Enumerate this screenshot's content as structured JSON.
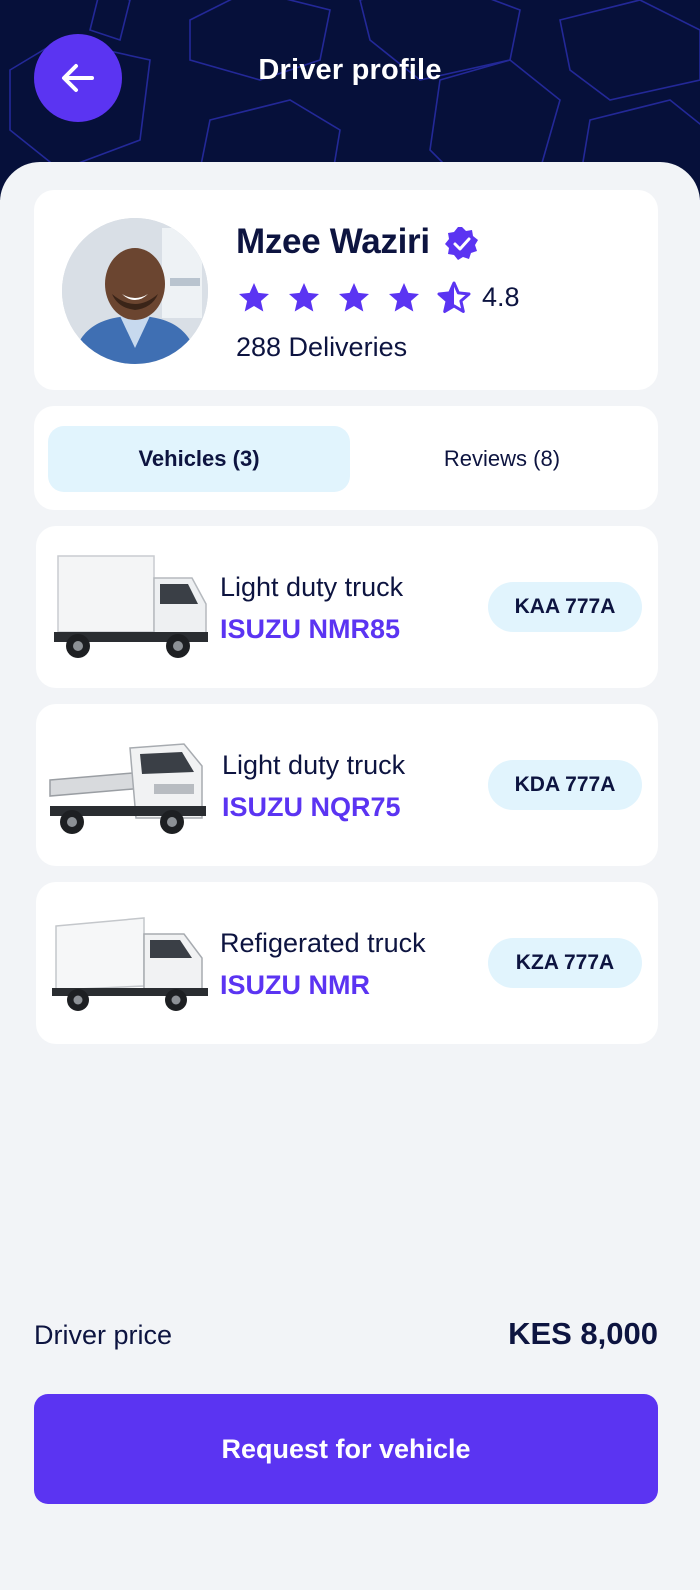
{
  "header": {
    "title": "Driver profile",
    "back_icon": "arrow-left-icon"
  },
  "driver": {
    "name": "Mzee Waziri",
    "verified_icon": "verified-badge-icon",
    "rating": "4.8",
    "rating_value": 4.5,
    "stars_max": 5,
    "deliveries": "288 Deliveries"
  },
  "tabs": [
    {
      "label": "Vehicles (3)",
      "active": true
    },
    {
      "label": "Reviews (8)",
      "active": false
    }
  ],
  "vehicles": [
    {
      "type": "Light duty truck",
      "model": "ISUZU NMR85",
      "plate": "KAA 777A",
      "image": "box-truck-image"
    },
    {
      "type": "Light duty truck",
      "model": "ISUZU NQR75",
      "plate": "KDA 777A",
      "image": "flatbed-truck-image"
    },
    {
      "type": "Refigerated truck",
      "model": "ISUZU NMR",
      "plate": "KZA 777A",
      "image": "refrigerated-truck-image"
    }
  ],
  "price": {
    "label": "Driver price",
    "value": "KES 8,000"
  },
  "cta": {
    "label": "Request for vehicle"
  },
  "colors": {
    "header_bg": "#06103a",
    "accent": "#5b34f2",
    "chip_bg": "#e1f4fd",
    "text": "#0d1440",
    "page_bg": "#f2f4f7"
  }
}
